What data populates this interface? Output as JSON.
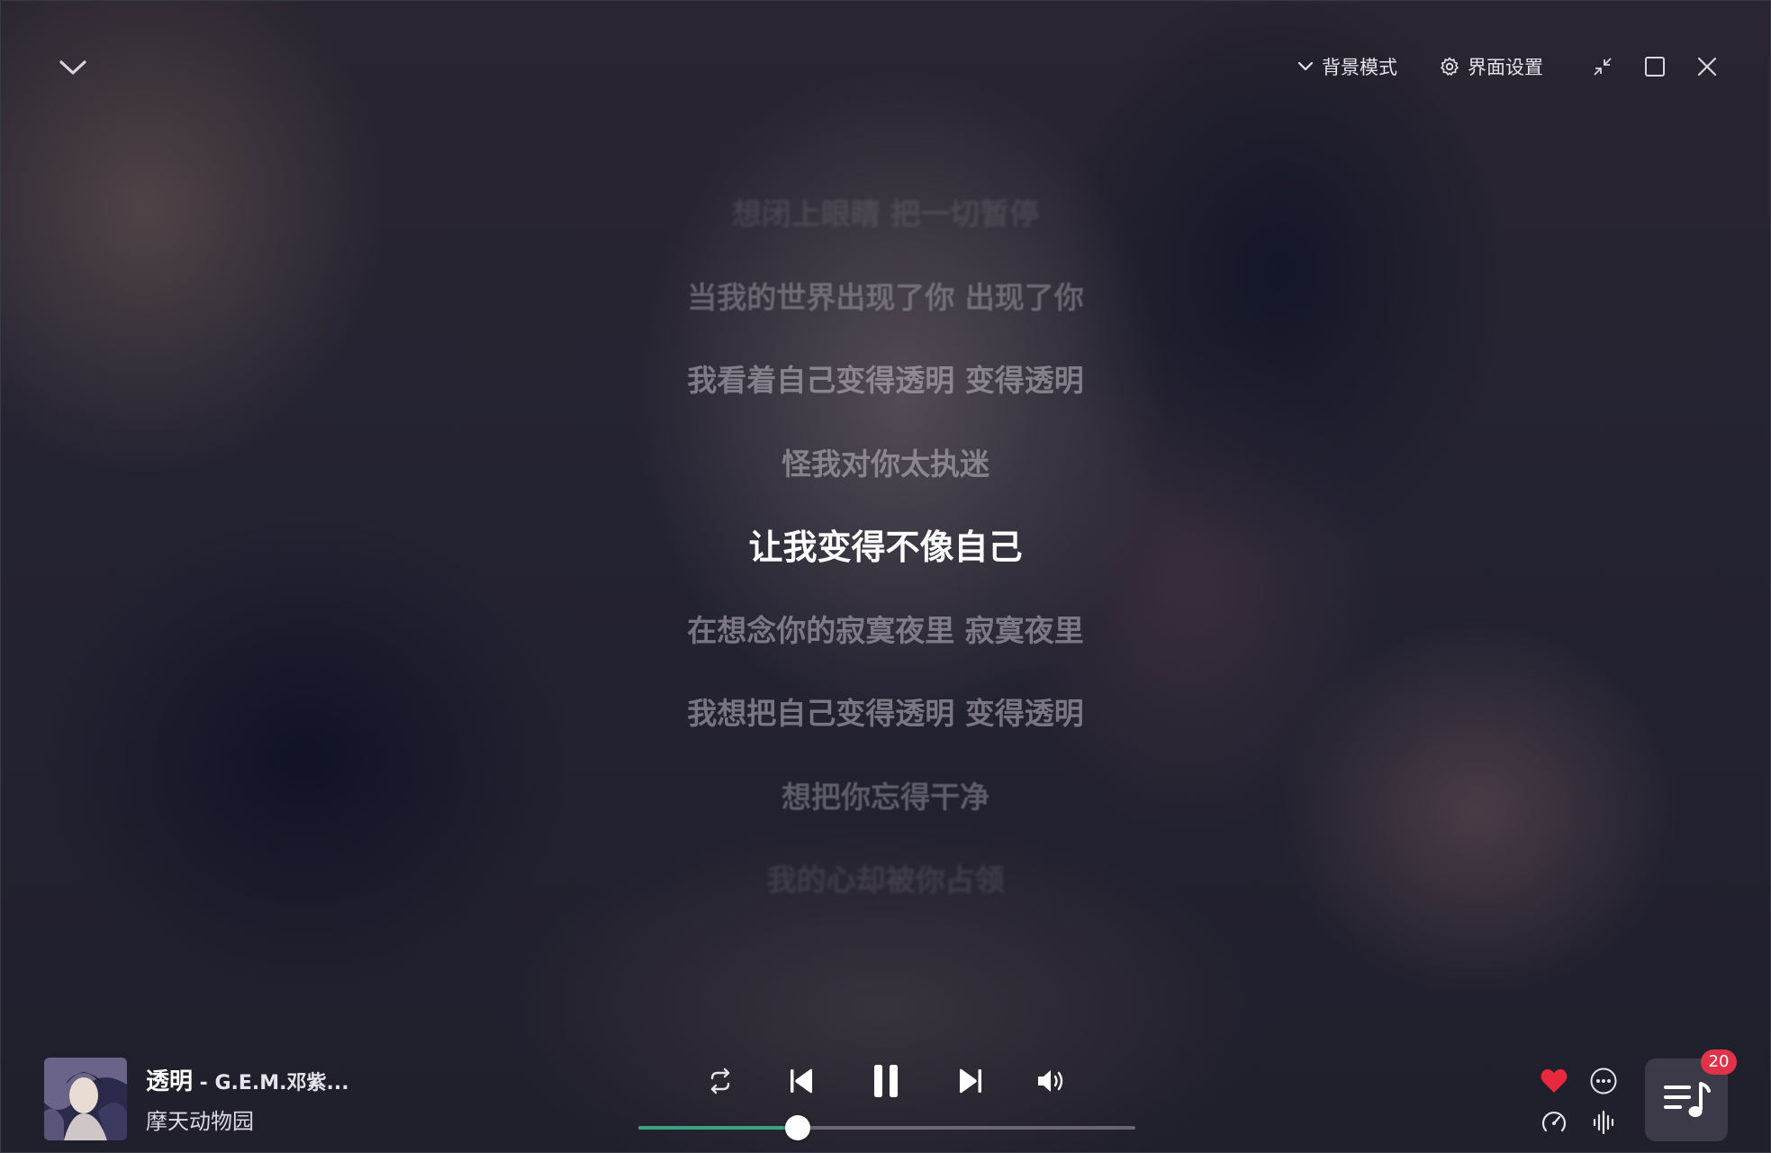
{
  "top_bar": {
    "background_mode_label": "背景模式",
    "settings_label": "界面设置"
  },
  "lyrics": [
    "想闭上眼睛 把一切暂停",
    "当我的世界出现了你 出现了你",
    "我看着自己变得透明 变得透明",
    "怪我对你太执迷",
    "让我变得不像自己",
    "在想念你的寂寞夜里 寂寞夜里",
    "我想把自己变得透明 变得透明",
    "想把你忘得干净",
    "我的心却被你占领"
  ],
  "current_lyric_index": 4,
  "now_playing": {
    "title": "透明",
    "separator": " - ",
    "artist": "G.E.M.邓紫...",
    "album": "摩天动物园",
    "liked": true
  },
  "player": {
    "progress": 0.32,
    "playlist_count": "20"
  },
  "colors": {
    "accent": "#3aa37e",
    "like": "#e8283c",
    "badge": "#e0334a"
  },
  "icons": {
    "collapse": "chevron-down-icon",
    "background_mode": "chevron-down-icon",
    "settings": "gear-icon",
    "shrink": "shrink-icon",
    "maximize": "maximize-icon",
    "close": "close-icon",
    "repeat": "repeat-icon",
    "previous": "previous-track-icon",
    "pause": "pause-icon",
    "next": "next-track-icon",
    "volume": "volume-icon",
    "like": "heart-icon",
    "more": "more-icon",
    "speed": "speed-icon",
    "sound_effect": "sound-wave-icon",
    "playlist": "playlist-icon"
  }
}
